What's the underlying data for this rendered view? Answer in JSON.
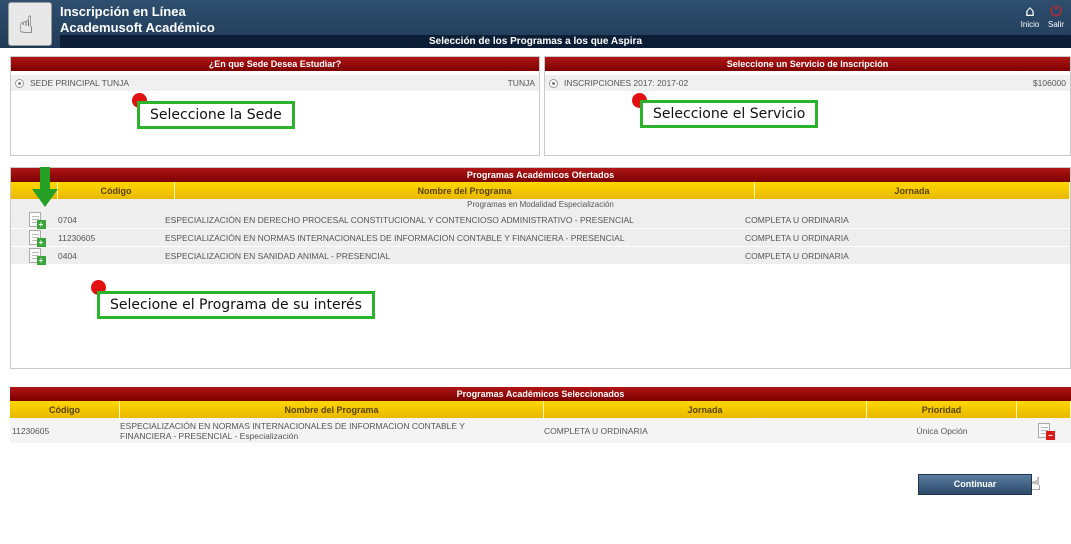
{
  "header": {
    "app_title": "Inscripción en Línea",
    "app_subtitle": "Academusoft Académico",
    "page_heading": "Selección de los Programas a los que Aspira",
    "home_label": "Inicio",
    "exit_label": "Salir",
    "home_icon": "home-icon",
    "exit_icon": "power-icon"
  },
  "sede_panel": {
    "title": "¿En que Sede Desea Estudiar?",
    "option_label": "SEDE PRINCIPAL TUNJA",
    "option_city": "TUNJA"
  },
  "service_panel": {
    "title": "Seleccione un Servicio de Inscripción",
    "option_label": "INSCRIPCIONES 2017: 2017-02",
    "option_price": "$106000"
  },
  "offered": {
    "title": "Programas Académicos Ofertados",
    "columns": [
      "Código",
      "Nombre del Programa",
      "Jornada"
    ],
    "group_label": "Programas en Modalidad Especialización",
    "rows": [
      {
        "code": "0704",
        "name": "ESPECIALIZACIÓN EN DERECHO PROCESAL CONSTITUCIONAL Y CONTENCIOSO ADMINISTRATIVO - PRESENCIAL",
        "shift": "COMPLETA U ORDINARIA"
      },
      {
        "code": "11230605",
        "name": "ESPECIALIZACIÓN EN NORMAS INTERNACIONALES DE INFORMACION CONTABLE Y FINANCIERA - PRESENCIAL",
        "shift": "COMPLETA U ORDINARIA"
      },
      {
        "code": "0404",
        "name": "ESPECIALIZACION EN SANIDAD ANIMAL - PRESENCIAL",
        "shift": "COMPLETA U ORDINARIA"
      }
    ]
  },
  "selected": {
    "title": "Programas Académicos Seleccionados",
    "columns": [
      "Código",
      "Nombre del Programa",
      "Jornada",
      "Prioridad"
    ],
    "rows": [
      {
        "code": "11230605",
        "name_line1": "ESPECIALIZACIÓN EN NORMAS INTERNACIONALES DE INFORMACION CONTABLE Y",
        "name_line2": "FINANCIERA - PRESENCIAL - Especialización",
        "shift": "COMPLETA U ORDINARIA",
        "priority": "Única Opción"
      }
    ]
  },
  "annotations": {
    "sede_note": "Seleccione la Sede",
    "service_note": "Seleccione el Servicio",
    "program_note": "Selecione el Programa de su interés"
  },
  "continue_label": "Continuar",
  "colors": {
    "header_bg": "#1f3a57",
    "panel_title_bg": "#9b0000",
    "column_header_bg": "#f2c500",
    "note_border": "#2bb32b",
    "marker": "#e21010"
  }
}
